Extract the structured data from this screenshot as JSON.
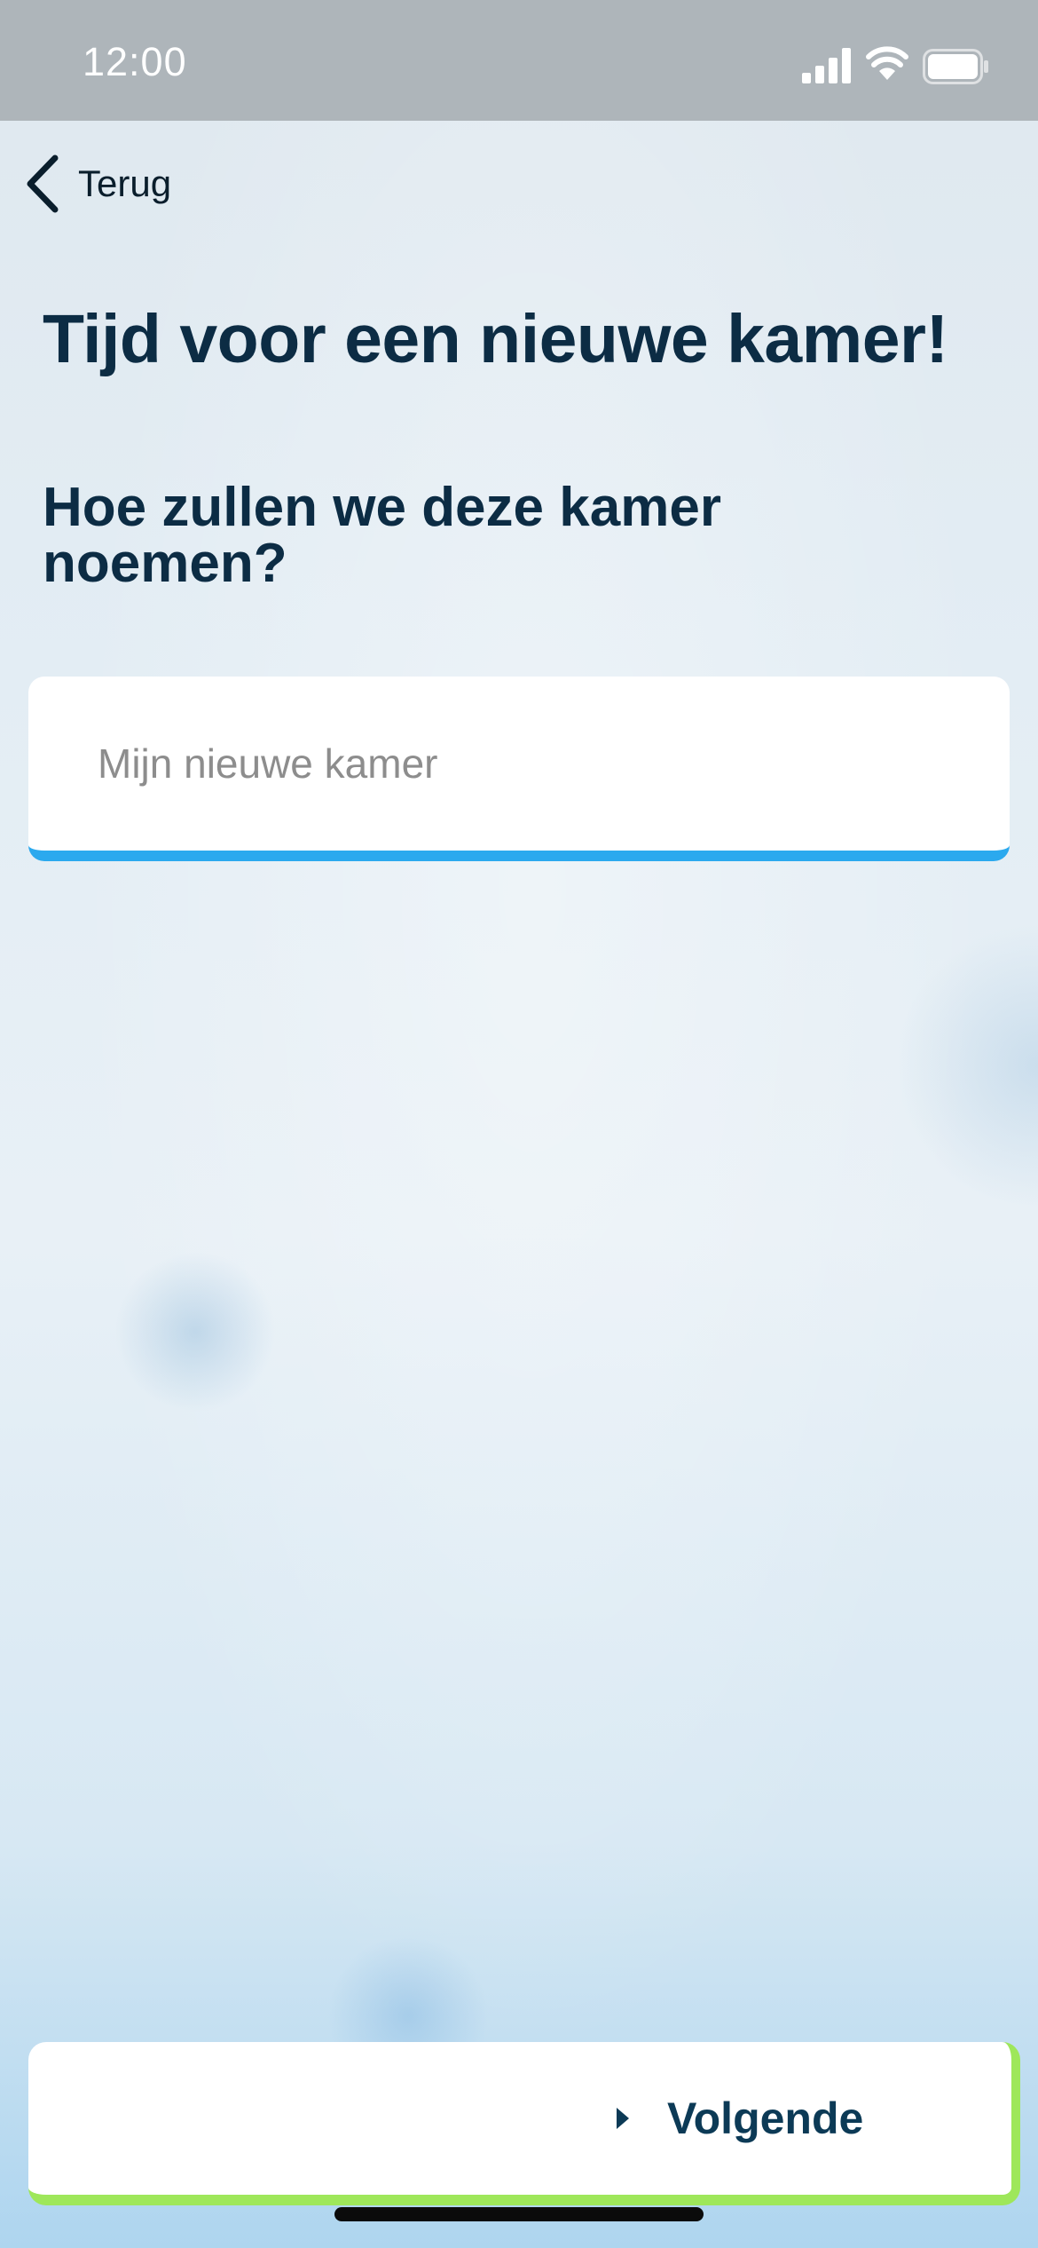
{
  "status_bar": {
    "time": "12:00",
    "icons": [
      "signal-icon",
      "wifi-icon",
      "battery-icon"
    ]
  },
  "nav": {
    "back_label": "Terug",
    "back_icon": "chevron-left-icon"
  },
  "content": {
    "title": "Tijd voor een nieuwe kamer!",
    "question": "Hoe zullen we deze kamer noemen?",
    "room_name_input": {
      "value": "",
      "placeholder": "Mijn nieuwe kamer"
    }
  },
  "footer": {
    "next_label": "Volgende",
    "next_icon": "caret-right-icon"
  },
  "colors": {
    "heading": "#0c2c44",
    "input_accent": "#2ba9ee",
    "button_accent": "#9ee75a",
    "status_bar": "#aeb5ba"
  }
}
